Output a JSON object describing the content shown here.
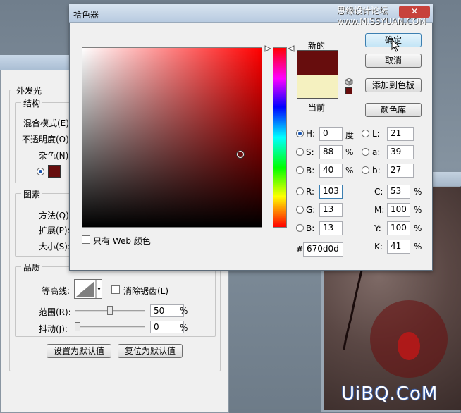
{
  "back_dialog": {
    "section_title": "外发光",
    "structure": {
      "title": "结构",
      "blend_mode_label": "混合模式(E):",
      "opacity_label": "不透明度(O):",
      "noise_label": "杂色(N):"
    },
    "elements": {
      "title": "图素",
      "method_label": "方法(Q):",
      "spread_label": "扩展(P):",
      "size_label": "大小(S):"
    },
    "quality": {
      "title": "品质",
      "contour_label": "等高线:",
      "antialias_label": "消除锯齿(L)",
      "range_label": "范围(R):",
      "range_value": "50",
      "range_unit": "%",
      "range_fraction": 0.5,
      "jitter_label": "抖动(J):",
      "jitter_value": "0",
      "jitter_unit": "%",
      "jitter_fraction": 0.0
    },
    "set_default_button": "设置为默认值",
    "reset_default_button": "复位为默认值",
    "glow_color": "#670d0d"
  },
  "picker": {
    "title": "拾色器",
    "ok_button": "确定",
    "cancel_button": "取消",
    "add_swatch_button": "添加到色板",
    "color_library_button": "颜色库",
    "new_label": "新的",
    "current_label": "当前",
    "new_color": "#670d0d",
    "current_color": "#f5f1c0",
    "web_only_label": "只有 Web 颜色",
    "hsb": {
      "h_label": "H:",
      "h_value": "0",
      "h_unit": "度",
      "s_label": "S:",
      "s_value": "88",
      "s_unit": "%",
      "b_label": "B:",
      "b_value": "40",
      "b_unit": "%"
    },
    "rgb": {
      "r_label": "R:",
      "r_value": "103",
      "g_label": "G:",
      "g_value": "13",
      "b_label": "B:",
      "b_value": "13"
    },
    "lab": {
      "l_label": "L:",
      "l_value": "21",
      "a_label": "a:",
      "a_value": "39",
      "b_label": "b:",
      "b_value": "27"
    },
    "cmyk": {
      "c_label": "C:",
      "c_value": "53",
      "c_unit": "%",
      "m_label": "M:",
      "m_value": "100",
      "m_unit": "%",
      "y_label": "Y:",
      "y_value": "100",
      "y_unit": "%",
      "k_label": "K:",
      "k_value": "41",
      "k_unit": "%"
    },
    "hex_label": "#",
    "hex_value": "670d0d"
  },
  "watermarks": {
    "top_right": "思缘设计论坛 www.MISSYUAN.COM",
    "bottom_right": "UiBQ.CoM"
  }
}
